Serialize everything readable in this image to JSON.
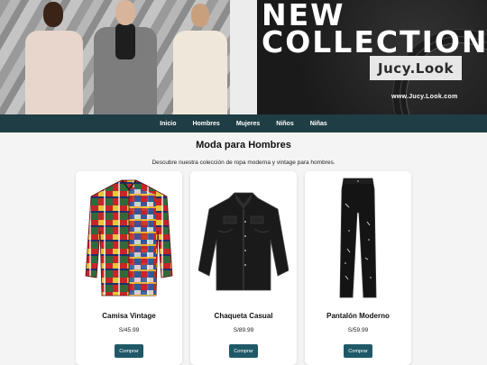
{
  "banner": {
    "title_line1": "NEW",
    "title_line2": "COLLECTION",
    "brand": "Jucy.Look",
    "website": "www.Jucy.Look.com"
  },
  "nav": {
    "items": [
      {
        "label": "Inicio"
      },
      {
        "label": "Hombres"
      },
      {
        "label": "Mujeres"
      },
      {
        "label": "Niños"
      },
      {
        "label": "Niñas"
      }
    ]
  },
  "main": {
    "title": "Moda para Hombres",
    "subtitle": "Descubre nuestra colección de ropa moderna y vintage para hombres."
  },
  "products": [
    {
      "name": "Camisa Vintage",
      "price": "S/45.99",
      "button": "Comprar",
      "image": "plaid-shirt"
    },
    {
      "name": "Chaqueta Casual",
      "price": "S/89.99",
      "button": "Comprar",
      "image": "leather-jacket"
    },
    {
      "name": "Pantalón Moderno",
      "price": "S/59.99",
      "button": "Comprar",
      "image": "black-jeans"
    }
  ],
  "colors": {
    "nav_bg": "#1f3d44",
    "button_bg": "#1f5968",
    "page_bg": "#f4f4f4"
  }
}
